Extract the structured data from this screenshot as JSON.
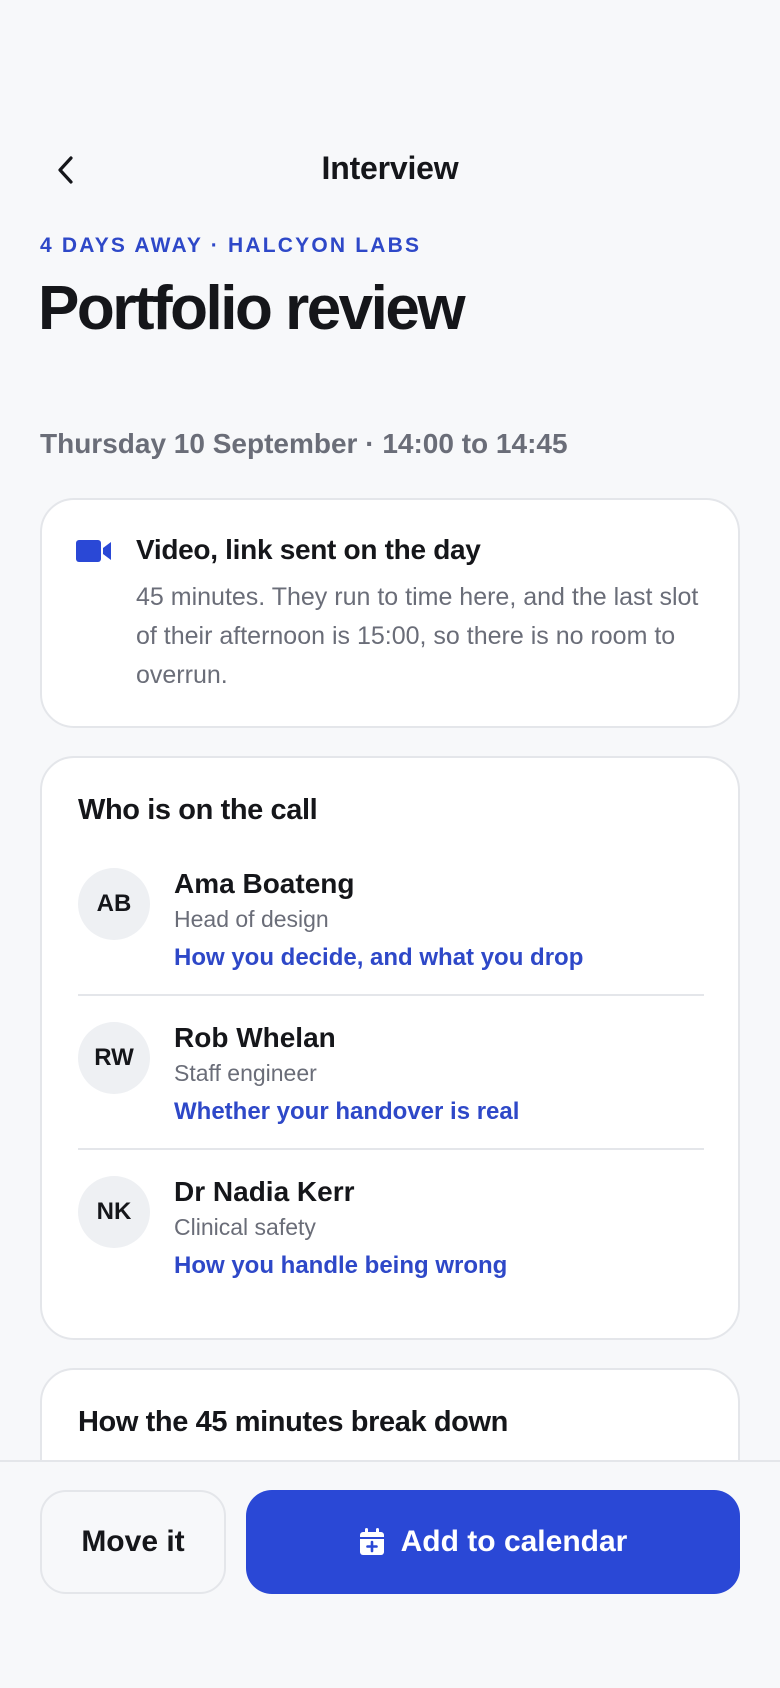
{
  "header": {
    "title": "Interview",
    "back_icon": "chevron-left-icon"
  },
  "event": {
    "eyebrow": "4 DAYS AWAY · HALCYON LABS",
    "title": "Portfolio review",
    "datetime": "Thursday 10 September · 14:00 to 14:45"
  },
  "format": {
    "icon": "video-camera-icon",
    "heading": "Video, link sent on the day",
    "body": "45 minutes. They run to time here, and the last slot of their afternoon is 15:00, so there is no room to overrun."
  },
  "people": {
    "heading": "Who is on the call",
    "items": [
      {
        "initials": "AB",
        "name": "Ama Boateng",
        "role": "Head of design",
        "focus": "How you decide, and what you drop"
      },
      {
        "initials": "RW",
        "name": "Rob Whelan",
        "role": "Staff engineer",
        "focus": "Whether your handover is real"
      },
      {
        "initials": "NK",
        "name": "Dr Nadia Kerr",
        "role": "Clinical safety",
        "focus": "How you handle being wrong"
      }
    ]
  },
  "breakdown": {
    "heading": "How the 45 minutes break down"
  },
  "actions": {
    "secondary_label": "Move it",
    "primary_label": "Add to calendar",
    "primary_icon": "calendar-add-icon"
  },
  "colors": {
    "accent": "#2a48d6",
    "link": "#2e48c8",
    "muted_text": "#6a6d78",
    "background": "#f7f8fa"
  }
}
